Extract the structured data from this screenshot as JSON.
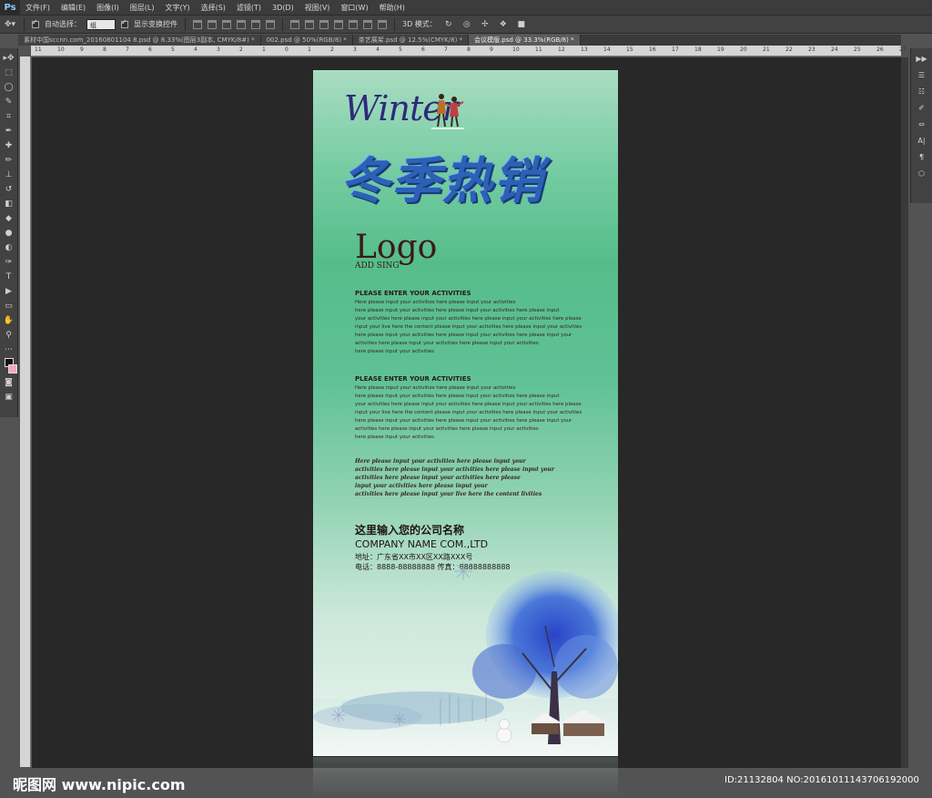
{
  "app": {
    "logo": "Ps",
    "menu": [
      "文件(F)",
      "编辑(E)",
      "图像(I)",
      "图层(L)",
      "文字(Y)",
      "选择(S)",
      "滤镜(T)",
      "3D(D)",
      "视图(V)",
      "窗口(W)",
      "帮助(H)"
    ]
  },
  "options": {
    "auto_select_label": "自动选择：",
    "auto_select_value": "组",
    "show_transform_label": "显示变换控件",
    "mode_3d_label": "3D 模式："
  },
  "tabs": [
    {
      "label": "素材中国sccnn.com_20160801104 8.psd @ 8.33%(图层3副本, CMYK/8#) *"
    },
    {
      "label": "002.psd @ 50%(RGB/8) *"
    },
    {
      "label": "茶艺展架.psd @ 12.5%(CMYK/8) *"
    },
    {
      "label": "会议模版.psd @ 33.3%(RGB/8) *"
    }
  ],
  "ruler_top": [
    "11",
    "10",
    "9",
    "8",
    "7",
    "6",
    "5",
    "4",
    "3",
    "2",
    "1",
    "0",
    "1",
    "2",
    "3",
    "4",
    "5",
    "6",
    "7",
    "8",
    "9",
    "10",
    "11",
    "12",
    "13",
    "14",
    "15",
    "16",
    "17",
    "18",
    "19",
    "20",
    "21",
    "22",
    "23",
    "24",
    "25",
    "26",
    "27"
  ],
  "poster": {
    "script_title": "Winter",
    "headline": "冬季热销",
    "logo": "Logo",
    "logo_sub": "ADD SING",
    "section1_title": "PLEASE ENTER YOUR ACTIVITIES",
    "section1_lines": [
      "Here please input your activities here please input your activities",
      "here please input your activities here please input your activities here please input",
      "your activities here please input your activities here please input your activities here please",
      "input your live here the content please input your activities here please input your activities",
      "here please input your activities here please input your activities here please input your",
      "activities here please input your activities here please input your activities",
      "here please input your activities"
    ],
    "section2_title": "PLEASE ENTER YOUR ACTIVITIES",
    "section2_lines": [
      "Here please input your activities here please input your activities",
      "here please input your activities here please input your activities here please input",
      "your activities here please input your activities here please input your activities here please",
      "input your live here the content please input your activities here please input your activities",
      "here please input your activities here please input your activities here please input your",
      "activities here please input your activities here please input your activities",
      "here please input your activities"
    ],
    "italic_lines": [
      "Here please input your activities here please input your",
      "activities here please input your activities here please input your",
      "activities here please input your activities here please",
      "input your activities here please input your",
      "activities here please input your live here the content livities"
    ],
    "company_cn": "这里输入您的公司名称",
    "company_en": "COMPANY NAME COM.,LTD",
    "address": "地址：广东省XX市XX区XX路XXX号",
    "phone": "电话：8888-88888888  传真：88888888888"
  },
  "watermark": {
    "left": "昵图网 www.nipic.com",
    "right": "ID:21132804 NO:20161011143706192000"
  }
}
